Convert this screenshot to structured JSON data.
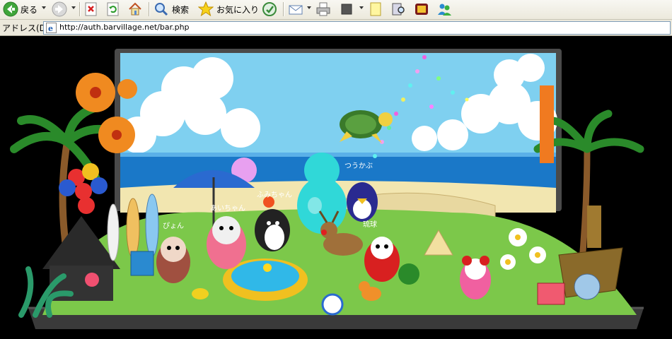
{
  "toolbar": {
    "back_label": "戻る",
    "search_label": "検索",
    "favorites_label": "お気に入り"
  },
  "address": {
    "label": "アドレス(D)",
    "url": "http://auth.barvillage.net/bar.php"
  },
  "scene": {
    "name_tags": {
      "turtle_area": "つうかぶ",
      "pink_girl": "あいちゃん",
      "penguin": "ふみちゃん",
      "left_character": "ぴょん",
      "blue_bird": "琉球"
    }
  },
  "colors": {
    "sky": "#7fd0f0",
    "sea": "#1a78c8",
    "grass": "#7cc84a",
    "frame": "#3a3a3a"
  }
}
